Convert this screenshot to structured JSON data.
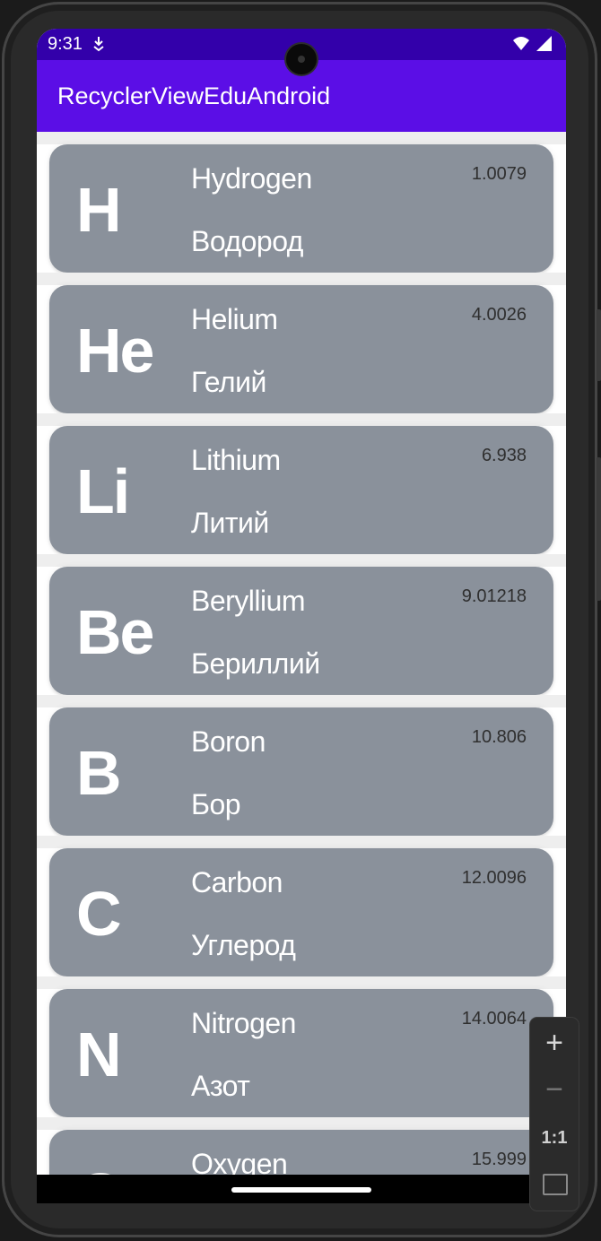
{
  "status_bar": {
    "time": "9:31",
    "icons": [
      "download-icon",
      "wifi-icon",
      "signal-icon"
    ]
  },
  "app_bar": {
    "title": "RecyclerViewEduAndroid"
  },
  "elements": [
    {
      "symbol": "H",
      "name_en": "Hydrogen",
      "name_ru": "Водород",
      "mass": "1.0079"
    },
    {
      "symbol": "He",
      "name_en": "Helium",
      "name_ru": "Гелий",
      "mass": "4.0026"
    },
    {
      "symbol": "Li",
      "name_en": "Lithium",
      "name_ru": "Литий",
      "mass": "6.938"
    },
    {
      "symbol": "Be",
      "name_en": "Beryllium",
      "name_ru": "Бериллий",
      "mass": "9.01218"
    },
    {
      "symbol": "B",
      "name_en": "Boron",
      "name_ru": "Бор",
      "mass": "10.806"
    },
    {
      "symbol": "C",
      "name_en": "Carbon",
      "name_ru": "Углерод",
      "mass": "12.0096"
    },
    {
      "symbol": "N",
      "name_en": "Nitrogen",
      "name_ru": "Азот",
      "mass": "14.0064"
    },
    {
      "symbol": "O",
      "name_en": "Oxygen",
      "name_ru": "",
      "mass": "15.999"
    }
  ],
  "zoom_controls": {
    "zoom_in": "+",
    "zoom_out": "−",
    "actual_size": "1:1"
  },
  "colors": {
    "status_bar": "#3300aa",
    "app_bar": "#5b0ee6",
    "card": "#8a919b"
  }
}
